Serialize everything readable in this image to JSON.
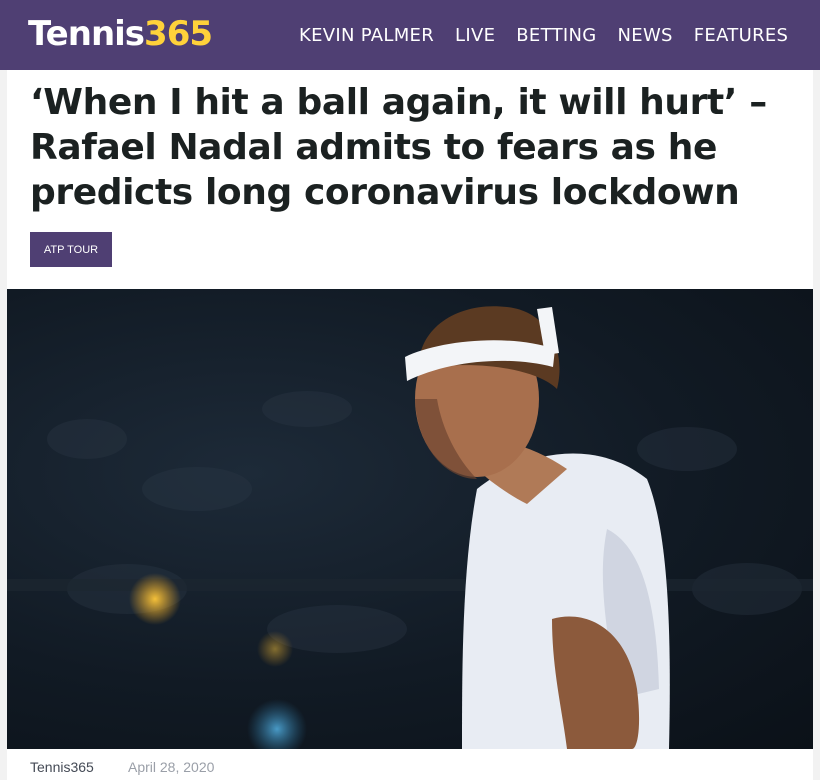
{
  "header": {
    "logo_main": "Tennis",
    "logo_number": "365",
    "nav": [
      "KEVIN PALMER",
      "LIVE",
      "BETTING",
      "NEWS",
      "FEATURES"
    ]
  },
  "article": {
    "headline": "‘When I hit a ball again, it will hurt’ – Rafael Nadal admits to fears as he predicts long coronavirus lockdown",
    "tag": "ATP TOUR",
    "author": "Tennis365",
    "date": "April 28, 2020"
  },
  "colors": {
    "brand_purple": "#4f3f73",
    "logo_yellow": "#ffd23a",
    "headline_text": "#1b2121"
  }
}
